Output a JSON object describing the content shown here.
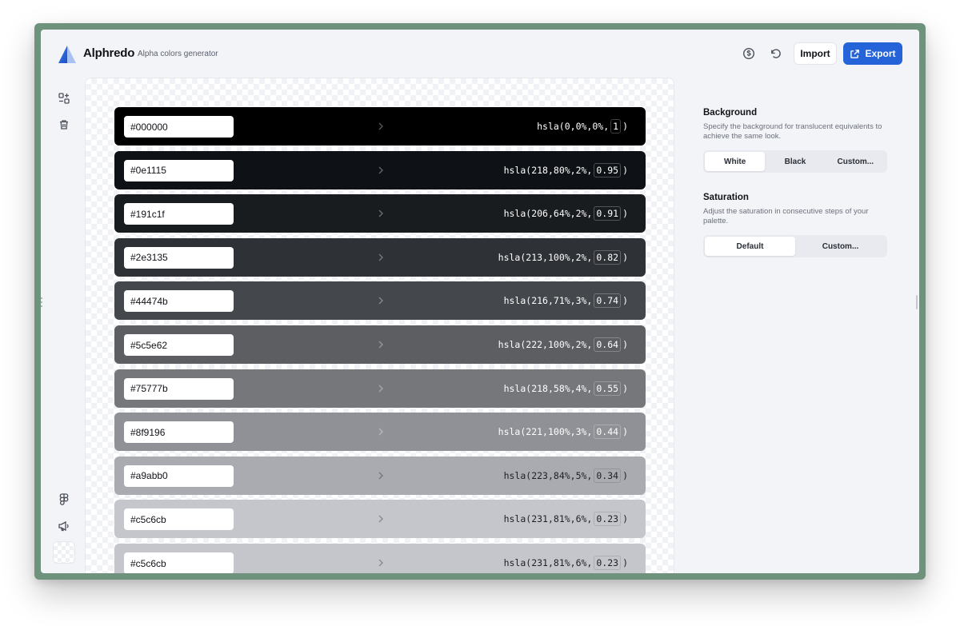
{
  "app": {
    "name": "Alphredo",
    "tagline": "Alpha colors generator"
  },
  "header": {
    "import_label": "Import",
    "export_label": "Export"
  },
  "swatches": [
    {
      "hex": "#000000",
      "bg": "#000000",
      "hsla_pre": "hsla(0,0%,0%,",
      "alpha": "1",
      "hsla_post": ")"
    },
    {
      "hex": "#0e1115",
      "bg": "#0e1115",
      "hsla_pre": "hsla(218,80%,2%,",
      "alpha": "0.95",
      "hsla_post": ")"
    },
    {
      "hex": "#191c1f",
      "bg": "#191c1f",
      "hsla_pre": "hsla(206,64%,2%,",
      "alpha": "0.91",
      "hsla_post": ")"
    },
    {
      "hex": "#2e3135",
      "bg": "#2e3135",
      "hsla_pre": "hsla(213,100%,2%,",
      "alpha": "0.82",
      "hsla_post": ")"
    },
    {
      "hex": "#44474b",
      "bg": "#44474b",
      "hsla_pre": "hsla(216,71%,3%,",
      "alpha": "0.74",
      "hsla_post": ")"
    },
    {
      "hex": "#5c5e62",
      "bg": "#5c5e62",
      "hsla_pre": "hsla(222,100%,2%,",
      "alpha": "0.64",
      "hsla_post": ")"
    },
    {
      "hex": "#75777b",
      "bg": "#75777b",
      "hsla_pre": "hsla(218,58%,4%,",
      "alpha": "0.55",
      "hsla_post": ")"
    },
    {
      "hex": "#8f9196",
      "bg": "#8f9196",
      "hsla_pre": "hsla(221,100%,3%,",
      "alpha": "0.44",
      "hsla_post": ")"
    },
    {
      "hex": "#a9abb0",
      "bg": "#a9abb0",
      "hsla_pre": "hsla(223,84%,5%,",
      "alpha": "0.34",
      "hsla_post": ")"
    },
    {
      "hex": "#c5c6cb",
      "bg": "#c5c6cb",
      "hsla_pre": "hsla(231,81%,6%,",
      "alpha": "0.23",
      "hsla_post": ")"
    },
    {
      "hex": "#c5c6cb",
      "bg": "#c5c6cb",
      "hsla_pre": "hsla(231,81%,6%,",
      "alpha": "0.23",
      "hsla_post": ")"
    }
  ],
  "background_section": {
    "title": "Background",
    "description": "Specify the background for translucent equivalents to achieve the same look.",
    "options": [
      "White",
      "Black",
      "Custom..."
    ],
    "selected": "White"
  },
  "saturation_section": {
    "title": "Saturation",
    "description": "Adjust the saturation in consecutive steps of your palette.",
    "options": [
      "Default",
      "Custom..."
    ],
    "selected": "Default"
  },
  "colors": {
    "accent": "#2463d8",
    "frame": "#6f927c"
  },
  "icons": [
    "logo-icon",
    "currency-icon",
    "reset-icon",
    "external-link-icon",
    "palette-grid-icon",
    "trash-icon",
    "figma-icon",
    "megaphone-icon"
  ]
}
